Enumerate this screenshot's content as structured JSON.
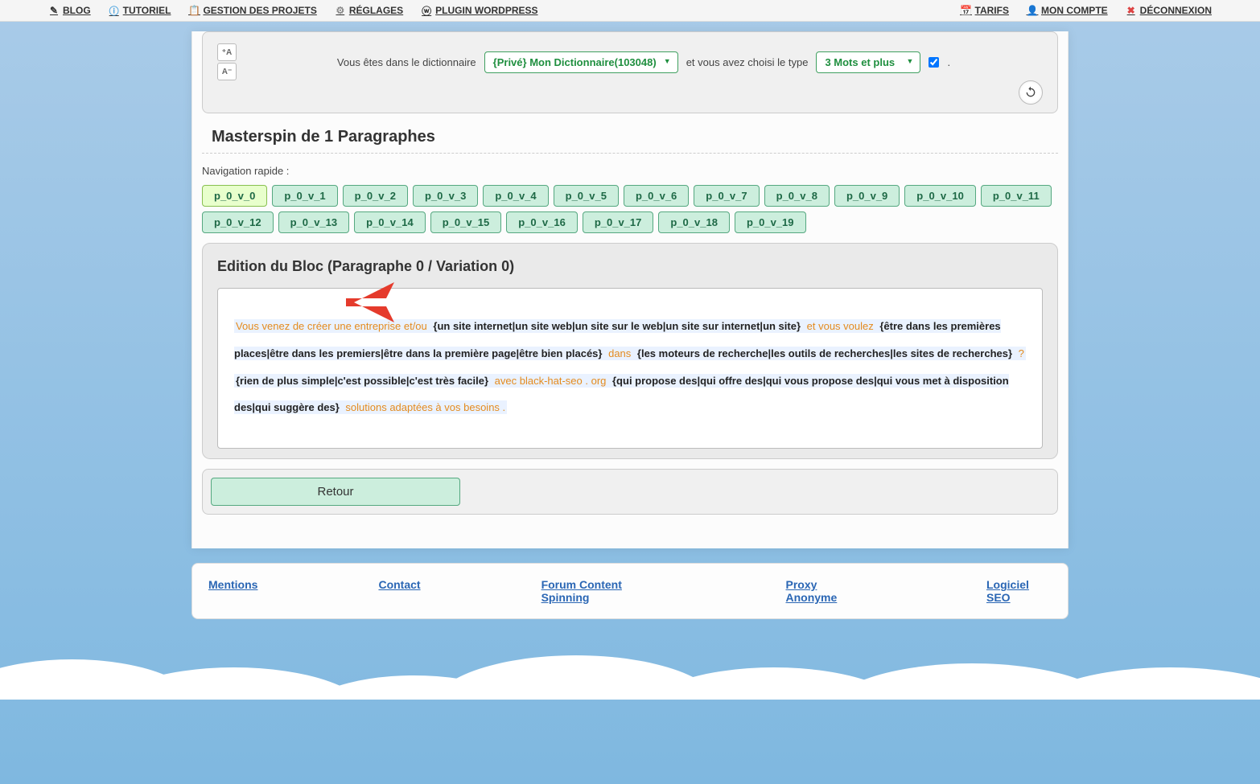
{
  "menu": {
    "blog": "BLOG",
    "tutoriel": "TUTORIEL",
    "gestion": "GESTION DES PROJETS",
    "reglages": "RÉGLAGES",
    "plugin": "PLUGIN WORDPRESS",
    "tarifs": "TARIFS",
    "compte": "MON COMPTE",
    "deconnexion": "DÉCONNEXION"
  },
  "top_panel": {
    "text_before": "Vous êtes dans le dictionnaire",
    "dict_select": "{Privé} Mon Dictionnaire(103048)",
    "text_mid": "et vous avez choisi le type",
    "type_select": "3 Mots et plus",
    "period": ".",
    "size_up": "⁺A",
    "size_down": "A⁻"
  },
  "title": "Masterspin de 1 Paragraphes",
  "nav_quick_label": "Navigation rapide :",
  "pills": [
    "p_0_v_0",
    "p_0_v_1",
    "p_0_v_2",
    "p_0_v_3",
    "p_0_v_4",
    "p_0_v_5",
    "p_0_v_6",
    "p_0_v_7",
    "p_0_v_8",
    "p_0_v_9",
    "p_0_v_10",
    "p_0_v_11",
    "p_0_v_12",
    "p_0_v_13",
    "p_0_v_14",
    "p_0_v_15",
    "p_0_v_16",
    "p_0_v_17",
    "p_0_v_18",
    "p_0_v_19"
  ],
  "editor": {
    "heading": "Edition du Bloc (Paragraphe 0 / Variation 0)",
    "seg1": "Vous venez de créer une entreprise et/ou ",
    "seg2": "{un site internet|un site web|un site sur le web|un site sur internet|un site}",
    "seg3": " et vous voulez ",
    "seg4": "{être dans les premières places|être dans les premiers|être dans la première page|être bien placés}",
    "seg5": " dans ",
    "seg6": "{les moteurs de recherche|les outils de recherches|les sites de recherches}",
    "seg7": " ? ",
    "seg8": "{rien de plus simple|c'est possible|c'est très facile}",
    "seg9": " avec black-hat-seo . org ",
    "seg10": "{qui propose des|qui offre des|qui vous propose des|qui vous met à disposition des|qui suggère des}",
    "seg11": " solutions adaptées à vos besoins ."
  },
  "back_button": "Retour",
  "footer": {
    "mentions": "Mentions",
    "contact": "Contact",
    "forum": "Forum Content Spinning",
    "proxy": "Proxy Anonyme",
    "logiciel": "Logiciel SEO"
  }
}
